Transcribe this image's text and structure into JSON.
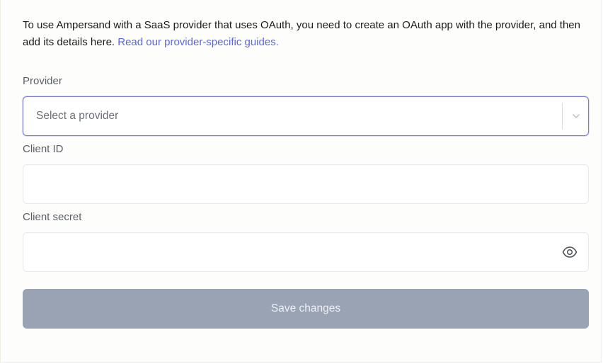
{
  "intro": {
    "text": "To use Ampersand with a SaaS provider that uses OAuth, you need to create an OAuth app with the provider, and then add its details here. ",
    "link_label": "Read our provider-specific guides."
  },
  "provider": {
    "label": "Provider",
    "placeholder": "Select a provider",
    "chevron_icon": "chevron-down-icon"
  },
  "client_id": {
    "label": "Client ID",
    "value": ""
  },
  "client_secret": {
    "label": "Client secret",
    "value": "",
    "toggle_icon": "eye-icon"
  },
  "actions": {
    "save_label": "Save changes"
  },
  "colors": {
    "link": "#5b68d6",
    "focus_border": "#7c79d4",
    "button_disabled_bg": "#99a3b3"
  }
}
